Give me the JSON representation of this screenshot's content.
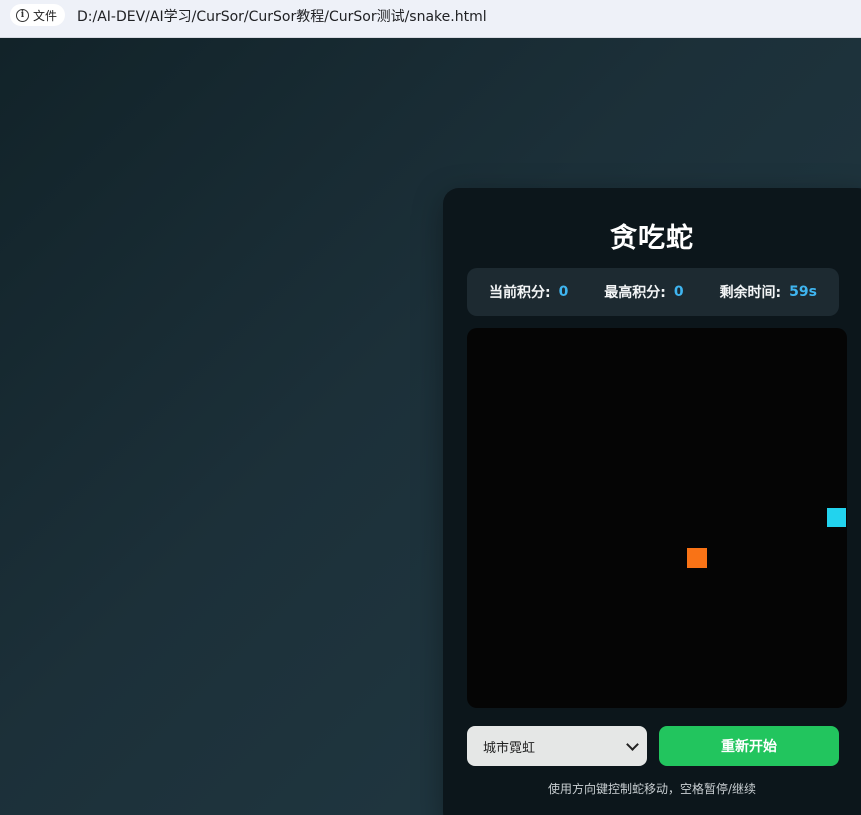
{
  "browser": {
    "site_info_label": "文件",
    "url": "D:/AI-DEV/AI学习/CurSor/CurSor教程/CurSor测试/snake.html"
  },
  "game": {
    "title": "贪吃蛇",
    "stats": {
      "current_score_label": "当前积分:",
      "current_score_value": "0",
      "high_score_label": "最高积分:",
      "high_score_value": "0",
      "time_left_label": "剩余时间:",
      "time_left_value": "59s"
    },
    "theme_select": {
      "selected": "城市霓虹"
    },
    "restart_label": "重新开始",
    "hint": "使用方向键控制蛇移动，空格暂停/继续"
  },
  "colors": {
    "snake": "#f97316",
    "food": "#22d3ee",
    "restart_button": "#22c55e",
    "stat_value": "#3fb5f0"
  }
}
